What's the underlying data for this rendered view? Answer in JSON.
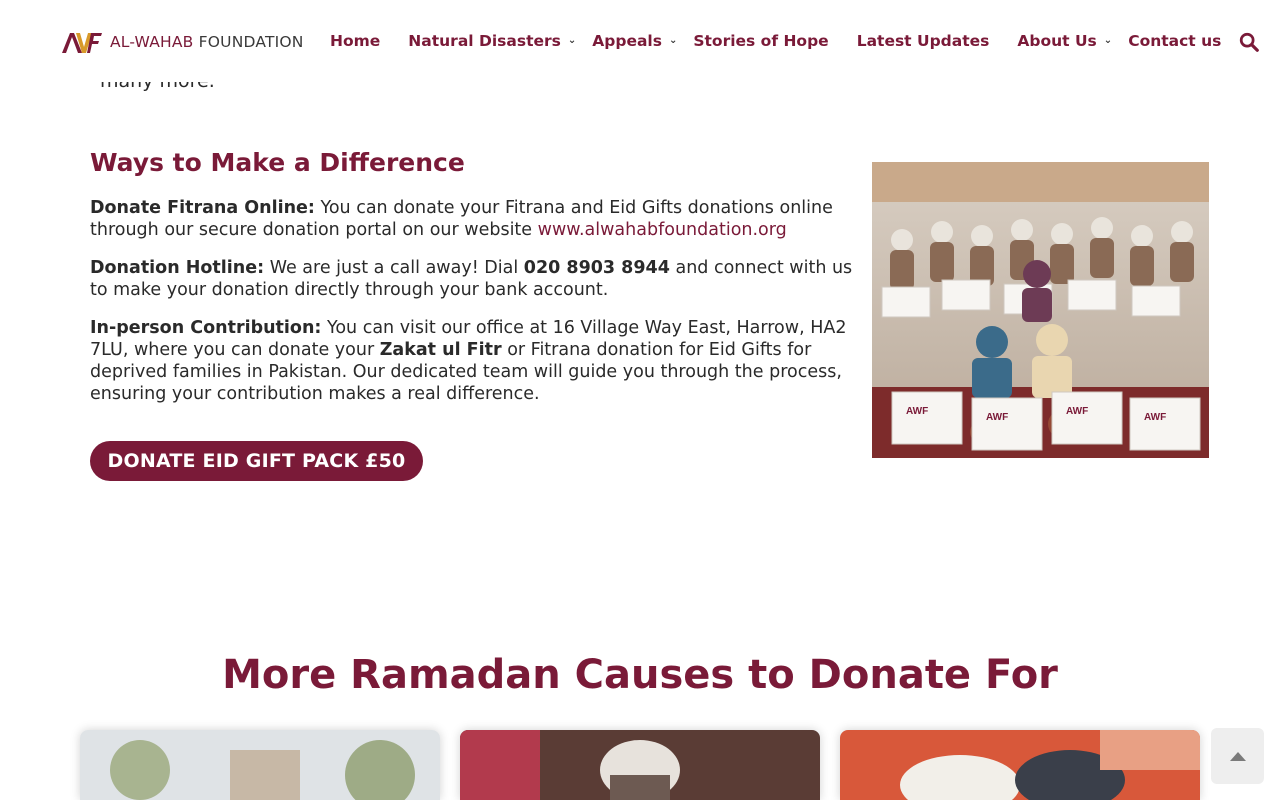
{
  "header": {
    "logo_mark": "AWF",
    "logo_brand": "AL-WAHAB",
    "logo_rest": " FOUNDATION",
    "nav": [
      {
        "label": "Home",
        "has_dropdown": false
      },
      {
        "label": "Natural Disasters",
        "has_dropdown": true
      },
      {
        "label": "Appeals",
        "has_dropdown": true
      },
      {
        "label": "Stories of Hope",
        "has_dropdown": false
      },
      {
        "label": "Latest Updates",
        "has_dropdown": false
      },
      {
        "label": "About Us",
        "has_dropdown": true
      },
      {
        "label": "Contact us",
        "has_dropdown": false
      }
    ],
    "search_icon": "search-icon"
  },
  "previous_fragment": "many more.",
  "section": {
    "title": "Ways to Make a Difference",
    "items": [
      {
        "lead": "Donate Fitrana Online:",
        "text": " You can donate your Fitrana and Eid Gifts donations online through our secure donation portal on our website ",
        "link": "www.alwahabfoundation.org"
      },
      {
        "lead": "Donation Hotline:",
        "text_a": " We are just a call away! Dial ",
        "phone": "020 8903 8944",
        "text_b": " and connect with us to make your donation directly through your bank account."
      },
      {
        "lead": "In-person Contribution:",
        "text_a": " You can visit our office at 16 Village Way East, Harrow, HA2 7LU, where you can donate your ",
        "bold": "Zakat ul Fitr",
        "text_b": " or Fitrana donation for Eid Gifts for deprived families in Pakistan. Our dedicated team will guide you through the process, ensuring your contribution makes a real difference."
      }
    ],
    "button_label": "DONATE EID GIFT PACK £50",
    "photo_box_label": "AWF"
  },
  "more": {
    "title": "More Ramadan Causes to Donate For"
  },
  "colors": {
    "brand": "#7a1a38",
    "text": "#2a2a2a"
  }
}
